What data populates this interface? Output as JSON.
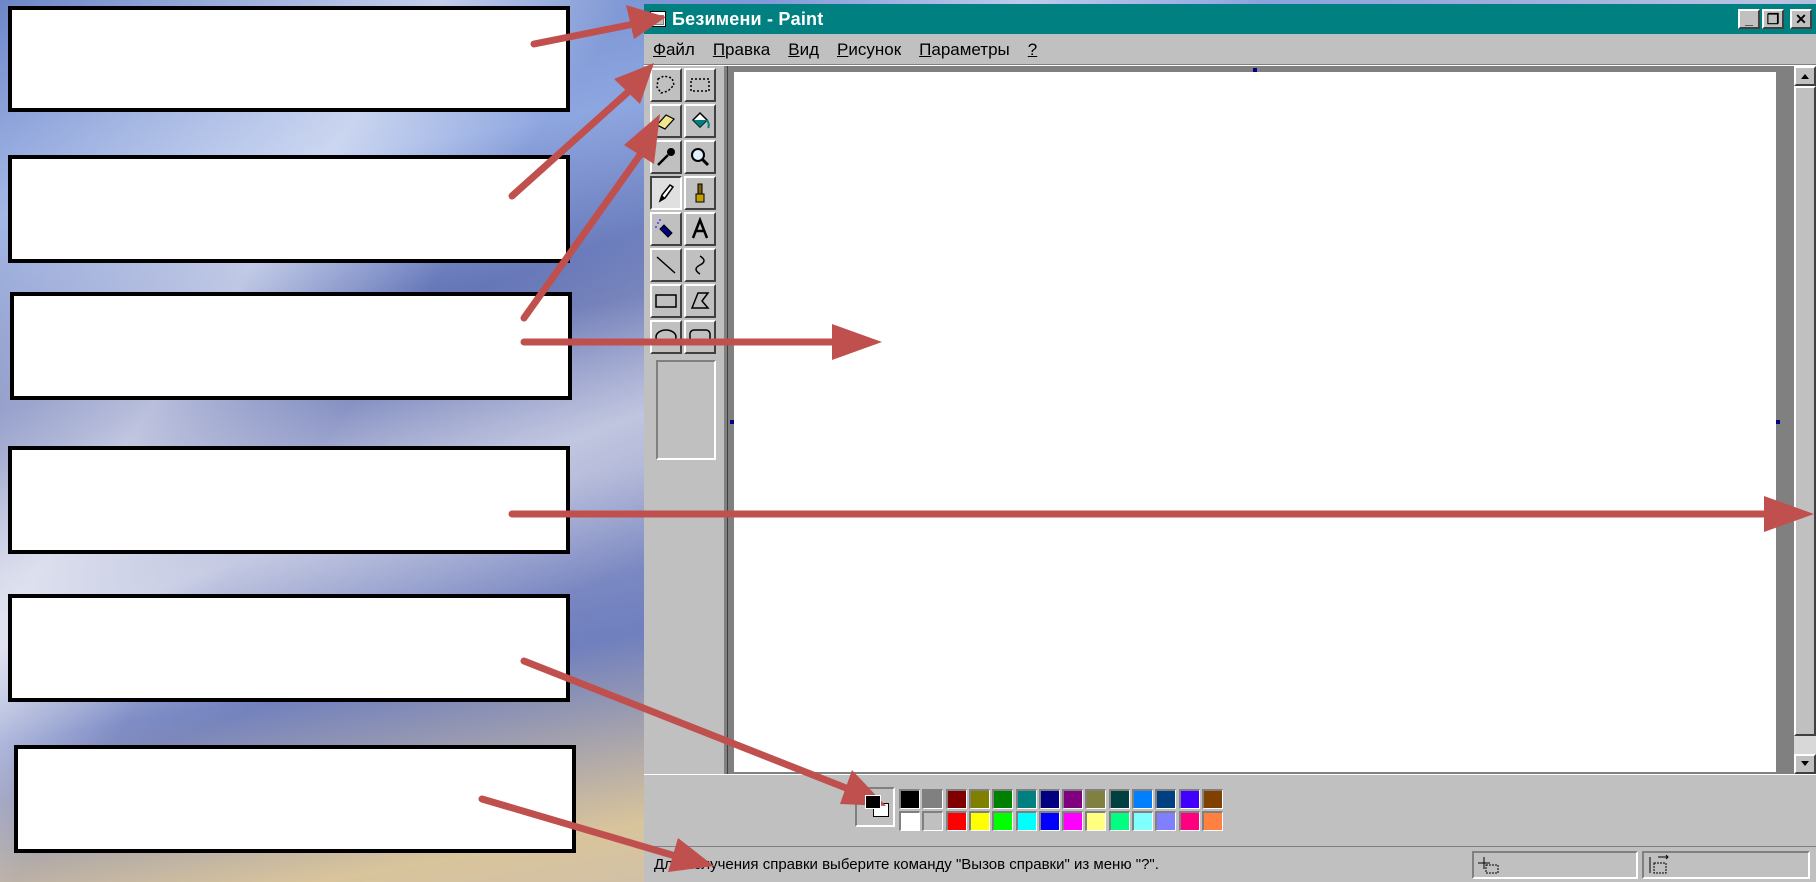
{
  "window": {
    "title": "Безимени - Paint",
    "min_glyph": "_",
    "max_glyph": "❐",
    "close_glyph": "✕"
  },
  "menu": {
    "items": [
      {
        "mnemonic": "Ф",
        "rest": "айл"
      },
      {
        "mnemonic": "П",
        "rest": "равка"
      },
      {
        "mnemonic": "В",
        "rest": "ид"
      },
      {
        "mnemonic": "Р",
        "rest": "исунок"
      },
      {
        "mnemonic": "П",
        "rest": "араметры"
      },
      {
        "mnemonic": "?",
        "rest": ""
      }
    ]
  },
  "tools": [
    "free-select",
    "rect-select",
    "eraser",
    "fill",
    "color-picker",
    "magnifier",
    "pencil",
    "brush",
    "airbrush",
    "text",
    "line",
    "curve",
    "rectangle",
    "polygon",
    "ellipse",
    "rounded-rectangle"
  ],
  "selected_tool": "pencil",
  "palette": {
    "top_row": [
      "#000000",
      "#808080",
      "#800000",
      "#808000",
      "#008000",
      "#008080",
      "#000080",
      "#800080",
      "#808040",
      "#004040",
      "#0080ff",
      "#004080",
      "#4000ff",
      "#804000"
    ],
    "bottom_row": [
      "#ffffff",
      "#c0c0c0",
      "#ff0000",
      "#ffff00",
      "#00ff00",
      "#00ffff",
      "#0000ff",
      "#ff00ff",
      "#ffff80",
      "#00ff80",
      "#80ffff",
      "#8080ff",
      "#ff0080",
      "#ff8040"
    ],
    "foreground": "#000000",
    "background": "#ffffff"
  },
  "status": {
    "text": "Для получения справки выберите команду \"Вызов справки\" из меню \"?\"."
  },
  "colors": {
    "title_bar": "#008080",
    "window_face": "#c0c0c0",
    "arrow": "#c0504d"
  }
}
